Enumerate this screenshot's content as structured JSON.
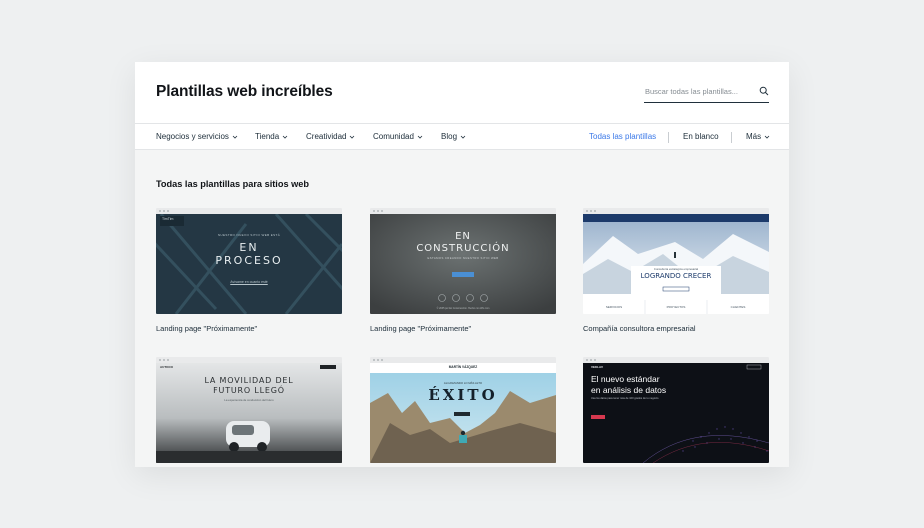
{
  "header": {
    "title": "Plantillas web increíbles"
  },
  "search": {
    "placeholder": "Buscar todas las plantillas..."
  },
  "nav": {
    "categories": [
      {
        "label": "Negocios y servicios"
      },
      {
        "label": "Tienda"
      },
      {
        "label": "Creatividad"
      },
      {
        "label": "Comunidad"
      },
      {
        "label": "Blog"
      }
    ],
    "all_templates": "Todas las plantillas",
    "blank": "En blanco",
    "more": "Más"
  },
  "section": {
    "title": "Todas las plantillas para sitios web"
  },
  "templates": [
    {
      "label": "Landing page \"Próximamente\"",
      "thumb_title_1": "EN",
      "thumb_title_2": "PROCESO",
      "thumb_logo": "TimTim",
      "thumb_small": "NUESTRO NUEVO SITIO WEB ESTÁ",
      "thumb_cta": "Avísame en cuanto esté"
    },
    {
      "label": "Landing page \"Próximamente\"",
      "thumb_title_1": "EN",
      "thumb_title_2": "CONSTRUCCIÓN",
      "thumb_small": "ESTAMOS CREANDO NUESTRO SITIO WEB",
      "thumb_footer": "© 2035 por En Construcción. Hecho con Wix.com"
    },
    {
      "label": "Compañía consultora empresarial",
      "thumb_title": "LOGRANDO CRECER",
      "thumb_small": "Consultoría estratégica empresarial",
      "thumb_cols": [
        "SERVICIOS",
        "PROYECTOS",
        "CLIENTES"
      ]
    },
    {
      "label": "",
      "thumb_title_1": "LA MOVILIDAD DEL",
      "thumb_title_2": "FUTURO LLEGÓ",
      "thumb_small": "La experiencia de conducción del futuro",
      "thumb_logo": "AUTOCO"
    },
    {
      "label": "",
      "thumb_title": "ÉXITO",
      "thumb_logo": "MARTÍN VÁZQUEZ",
      "thumb_small": "ALCANZANDO LO MÁS ALTO"
    },
    {
      "label": "",
      "thumb_title_1": "El nuevo estándar",
      "thumb_title_2": "en análisis de datos",
      "thumb_small": "Usa los datos para tener más de 100 grados de tu negocio",
      "thumb_logo": "VEKLAV"
    }
  ],
  "colors": {
    "accent": "#3b79e8",
    "title": "#111418",
    "text": "#20303c"
  }
}
